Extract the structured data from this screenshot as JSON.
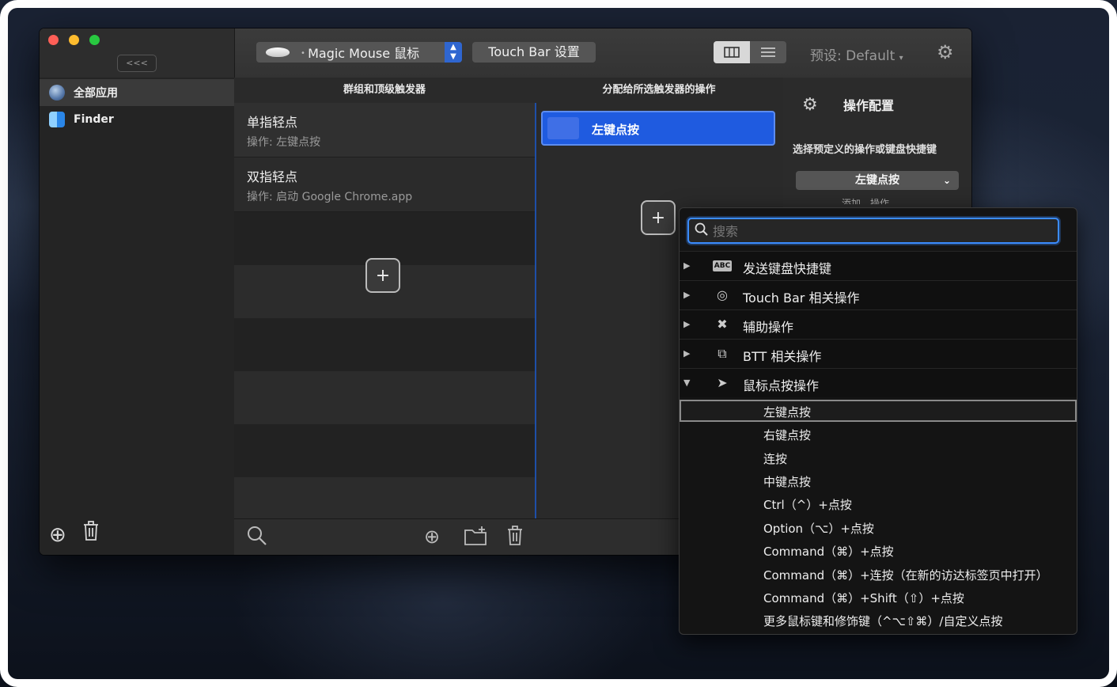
{
  "titlebar": {
    "collapse_label": "<<<",
    "device_label": "Magic Mouse 鼠标",
    "touchbar_label": "Touch Bar 设置",
    "preset_label": "预设: Default",
    "preset_arrow": "▾"
  },
  "sidebar": {
    "items": [
      {
        "label": "全部应用",
        "icon": "globe-icon"
      },
      {
        "label": "Finder",
        "icon": "finder-icon"
      }
    ]
  },
  "columns": {
    "triggers_header": "群组和顶级触发器",
    "actions_header": "分配给所选触发器的操作"
  },
  "triggers": [
    {
      "title": "单指轻点",
      "subtitle": "操作: 左键点按"
    },
    {
      "title": "双指轻点",
      "subtitle": "操作: 启动 Google Chrome.app"
    }
  ],
  "actions": [
    {
      "label": "左键点按"
    }
  ],
  "config": {
    "title": "操作配置",
    "subtitle": "选择预定义的操作或键盘快捷键",
    "selected": "左键点按",
    "partial_hint": "添加…操作"
  },
  "dropdown": {
    "search_placeholder": "搜索",
    "categories": [
      {
        "label": "发送键盘快捷键",
        "icon": "keyboard-abc-icon",
        "expanded": false
      },
      {
        "label": "Touch Bar 相关操作",
        "icon": "touchbar-icon",
        "expanded": false
      },
      {
        "label": "辅助操作",
        "icon": "tools-icon",
        "expanded": false
      },
      {
        "label": "BTT 相关操作",
        "icon": "btt-icon",
        "expanded": false
      },
      {
        "label": "鼠标点按操作",
        "icon": "cursor-icon",
        "expanded": true
      }
    ],
    "mouse_items": [
      "左键点按",
      "右键点按",
      "连按",
      "中键点按",
      "Ctrl（^）+点按",
      "Option（⌥）+点按",
      "Command（⌘）+点按",
      "Command（⌘）+连按（在新的访达标签页中打开）",
      "Command（⌘）+Shift（⇧）+点按",
      "更多鼠标键和修饰键（^⌥⇧⌘）/自定义点按"
    ]
  }
}
